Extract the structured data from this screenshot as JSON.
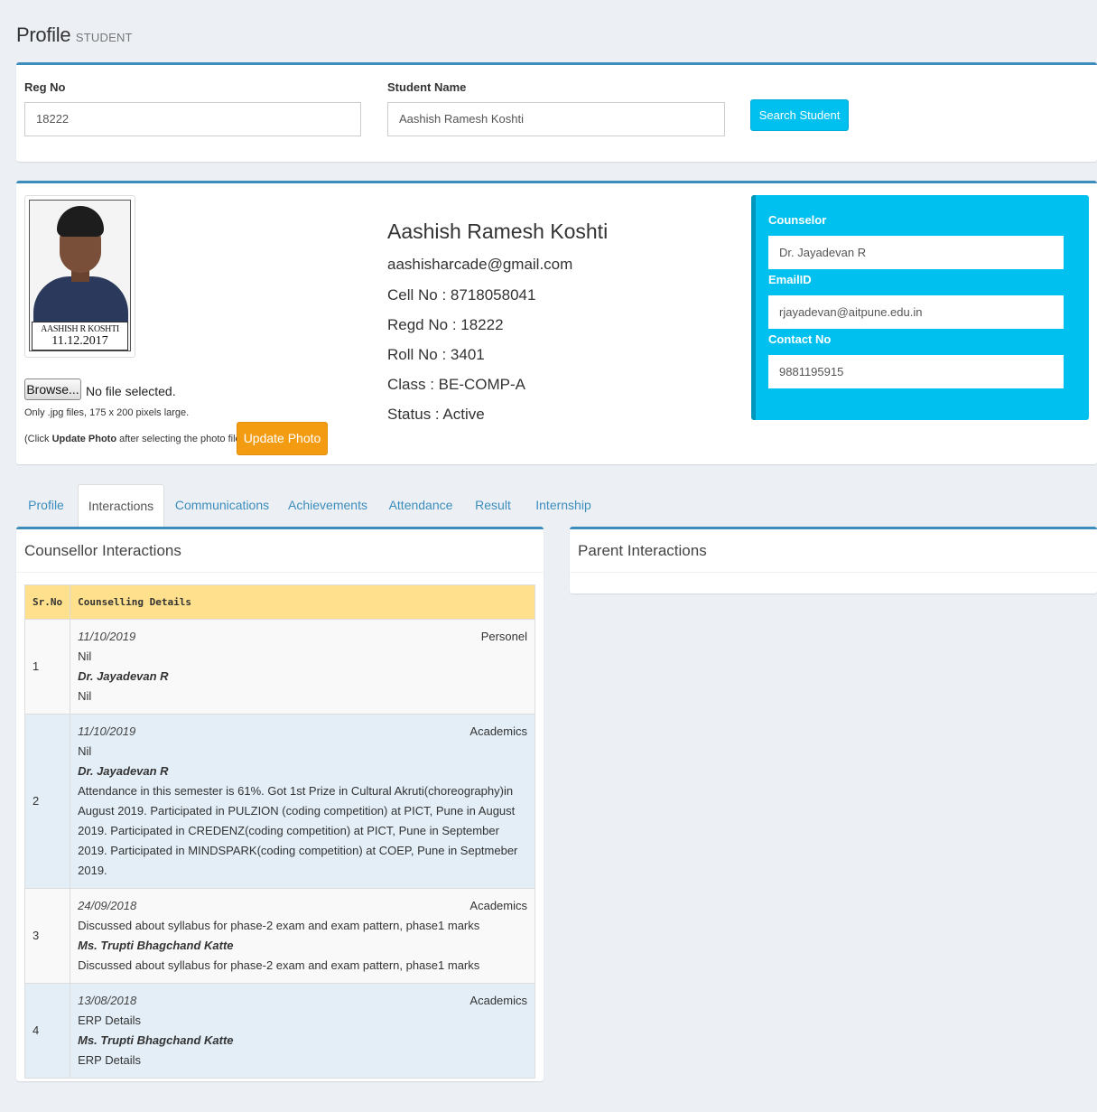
{
  "header": {
    "title": "Profile",
    "subtitle": "STUDENT"
  },
  "search": {
    "reg_label": "Reg No",
    "reg_value": "18222",
    "name_label": "Student Name",
    "name_value": "Aashish Ramesh  Koshti",
    "button": "Search Student"
  },
  "student": {
    "photo_caption_1": "AASHISH R KOSHTI",
    "photo_caption_2": "11.12.2017",
    "name": "Aashish Ramesh Koshti",
    "email": "aashisharcade@gmail.com",
    "cell": "Cell No : 8718058041",
    "regd": "Regd No : 18222",
    "roll": "Roll No : 3401",
    "class": "Class : BE-COMP-A",
    "status": "Status : Active",
    "browse_label": "Browse...",
    "file_status": "No file selected.",
    "hint1": "Only .jpg files, 175 x 200 pixels large.",
    "hint2_pre": "(Click ",
    "hint2_bold": "Update Photo",
    "hint2_post": " after selecting the photo file)",
    "update_button": "Update Photo"
  },
  "counselor": {
    "counselor_label": "Counselor",
    "counselor_value": "Dr.  Jayadevan R",
    "email_label": "EmailID",
    "email_value": "rjayadevan@aitpune.edu.in",
    "contact_label": "Contact No",
    "contact_value": "9881195915"
  },
  "tabs": [
    {
      "label": "Profile"
    },
    {
      "label": "Interactions"
    },
    {
      "label": "Communications"
    },
    {
      "label": "Achievements"
    },
    {
      "label": "Attendance"
    },
    {
      "label": "Result"
    },
    {
      "label": "Internship"
    }
  ],
  "active_tab": "Interactions",
  "counsellor_interactions": {
    "title": "Counsellor Interactions",
    "col_sr": "Sr.No",
    "col_details": "Counselling Details",
    "rows": [
      {
        "sr": "1",
        "date": "11/10/2019",
        "type": "Personel",
        "topic": "Nil",
        "by": "Dr. Jayadevan R",
        "details": "Nil"
      },
      {
        "sr": "2",
        "date": "11/10/2019",
        "type": "Academics",
        "topic": "Nil",
        "by": "Dr. Jayadevan R",
        "details": "Attendance in this semester is 61%. Got 1st Prize in Cultural Akruti(choreography)in August 2019. Participated in PULZION (coding competition) at PICT, Pune in August 2019. Participated in CREDENZ(coding competition) at PICT, Pune in September 2019. Participated in MINDSPARK(coding competition) at COEP, Pune in Septmeber 2019."
      },
      {
        "sr": "3",
        "date": "24/09/2018",
        "type": "Academics",
        "topic": "Discussed about syllabus for phase-2 exam and exam pattern, phase1 marks",
        "by": "Ms. Trupti Bhagchand Katte",
        "details": "Discussed about syllabus for phase-2 exam and exam pattern, phase1 marks"
      },
      {
        "sr": "4",
        "date": "13/08/2018",
        "type": "Academics",
        "topic": "ERP Details",
        "by": "Ms. Trupti Bhagchand Katte",
        "details": "ERP Details"
      }
    ]
  },
  "parent_interactions": {
    "title": "Parent Interactions"
  },
  "colors": {
    "primary": "#3c8dbc",
    "info": "#00c0ef",
    "warning": "#f39c12",
    "table_header": "#ffe08c",
    "background": "#ecf0f5"
  }
}
